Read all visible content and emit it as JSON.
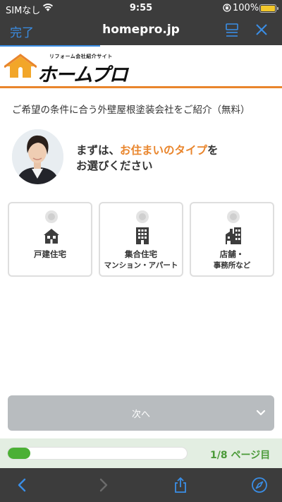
{
  "status_bar": {
    "carrier": "SIMなし",
    "time": "9:55",
    "battery_percent": "100%",
    "battery_level": 1.0
  },
  "browser": {
    "done_label": "完了",
    "domain": "homepro.jp",
    "icons": [
      "reader-icon",
      "close-icon"
    ]
  },
  "site": {
    "tagline": "リフォーム会社紹介サイト",
    "logo_text": "ホームプロ",
    "brand_color": "#e9852c"
  },
  "content": {
    "intro": "ご希望の条件に合う外壁屋根塗装会社をご紹介（無料）",
    "question_prefix": "まずは、",
    "question_accent": "お住まいのタイプ",
    "question_suffix": "を",
    "question_line2": "お選びください",
    "options": [
      {
        "label": "戸建住宅",
        "sub": "",
        "icon": "house-icon"
      },
      {
        "label": "集合住宅",
        "sub": "マンション・アパート",
        "icon": "apartment-building-icon"
      },
      {
        "label": "店舗・",
        "sub": "事務所など",
        "icon": "shop-building-icon"
      }
    ],
    "next_label": "次へ"
  },
  "progress": {
    "current": 1,
    "total": 8,
    "fraction": 0.125,
    "label": "1/8 ページ目",
    "color": "#4bb035"
  },
  "toolbar": {
    "icons": [
      "back-icon",
      "forward-icon",
      "share-icon",
      "safari-compass-icon"
    ]
  }
}
